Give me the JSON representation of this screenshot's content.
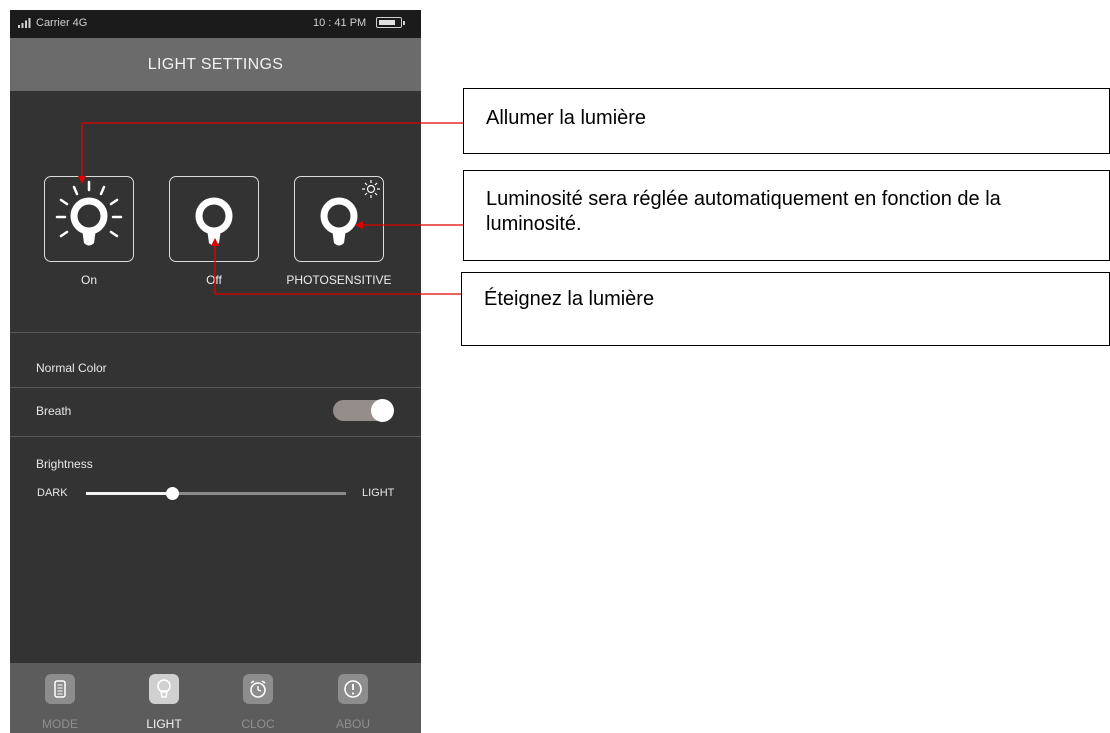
{
  "status_bar": {
    "carrier": "Carrier 4G",
    "time": "10 : 41 PM"
  },
  "header": {
    "title": "LIGHT SETTINGS"
  },
  "modes": [
    {
      "label": "On",
      "icon": "bulb-on-icon"
    },
    {
      "label": "Off",
      "icon": "bulb-off-icon"
    },
    {
      "label": "PHOTOSENSITIVE",
      "icon": "bulb-photosensitive-icon"
    }
  ],
  "settings": {
    "normal_color": "Normal Color",
    "breath": {
      "label": "Breath",
      "on": true
    },
    "brightness": {
      "label": "Brightness",
      "min_label": "DARK",
      "max_label": "LIGHT",
      "value": 0.33
    }
  },
  "tabs": [
    {
      "label": "MODE",
      "icon": "list-icon",
      "active": false
    },
    {
      "label": "LIGHT",
      "icon": "bulb-icon",
      "active": true
    },
    {
      "label": "CLOC",
      "icon": "alarm-clock-icon",
      "active": false
    },
    {
      "label": "ABOU",
      "icon": "info-icon",
      "active": false
    }
  ],
  "callouts": {
    "on": "Allumer la lumière",
    "photosensitive": "Luminosité sera réglée automatiquement en fonction de la luminosité.",
    "off": "Éteignez la lumière"
  },
  "colors": {
    "arrow": "#e00000",
    "background": "#333333",
    "header": "#6b6b6b",
    "tabbar": "#5c5c5c"
  }
}
